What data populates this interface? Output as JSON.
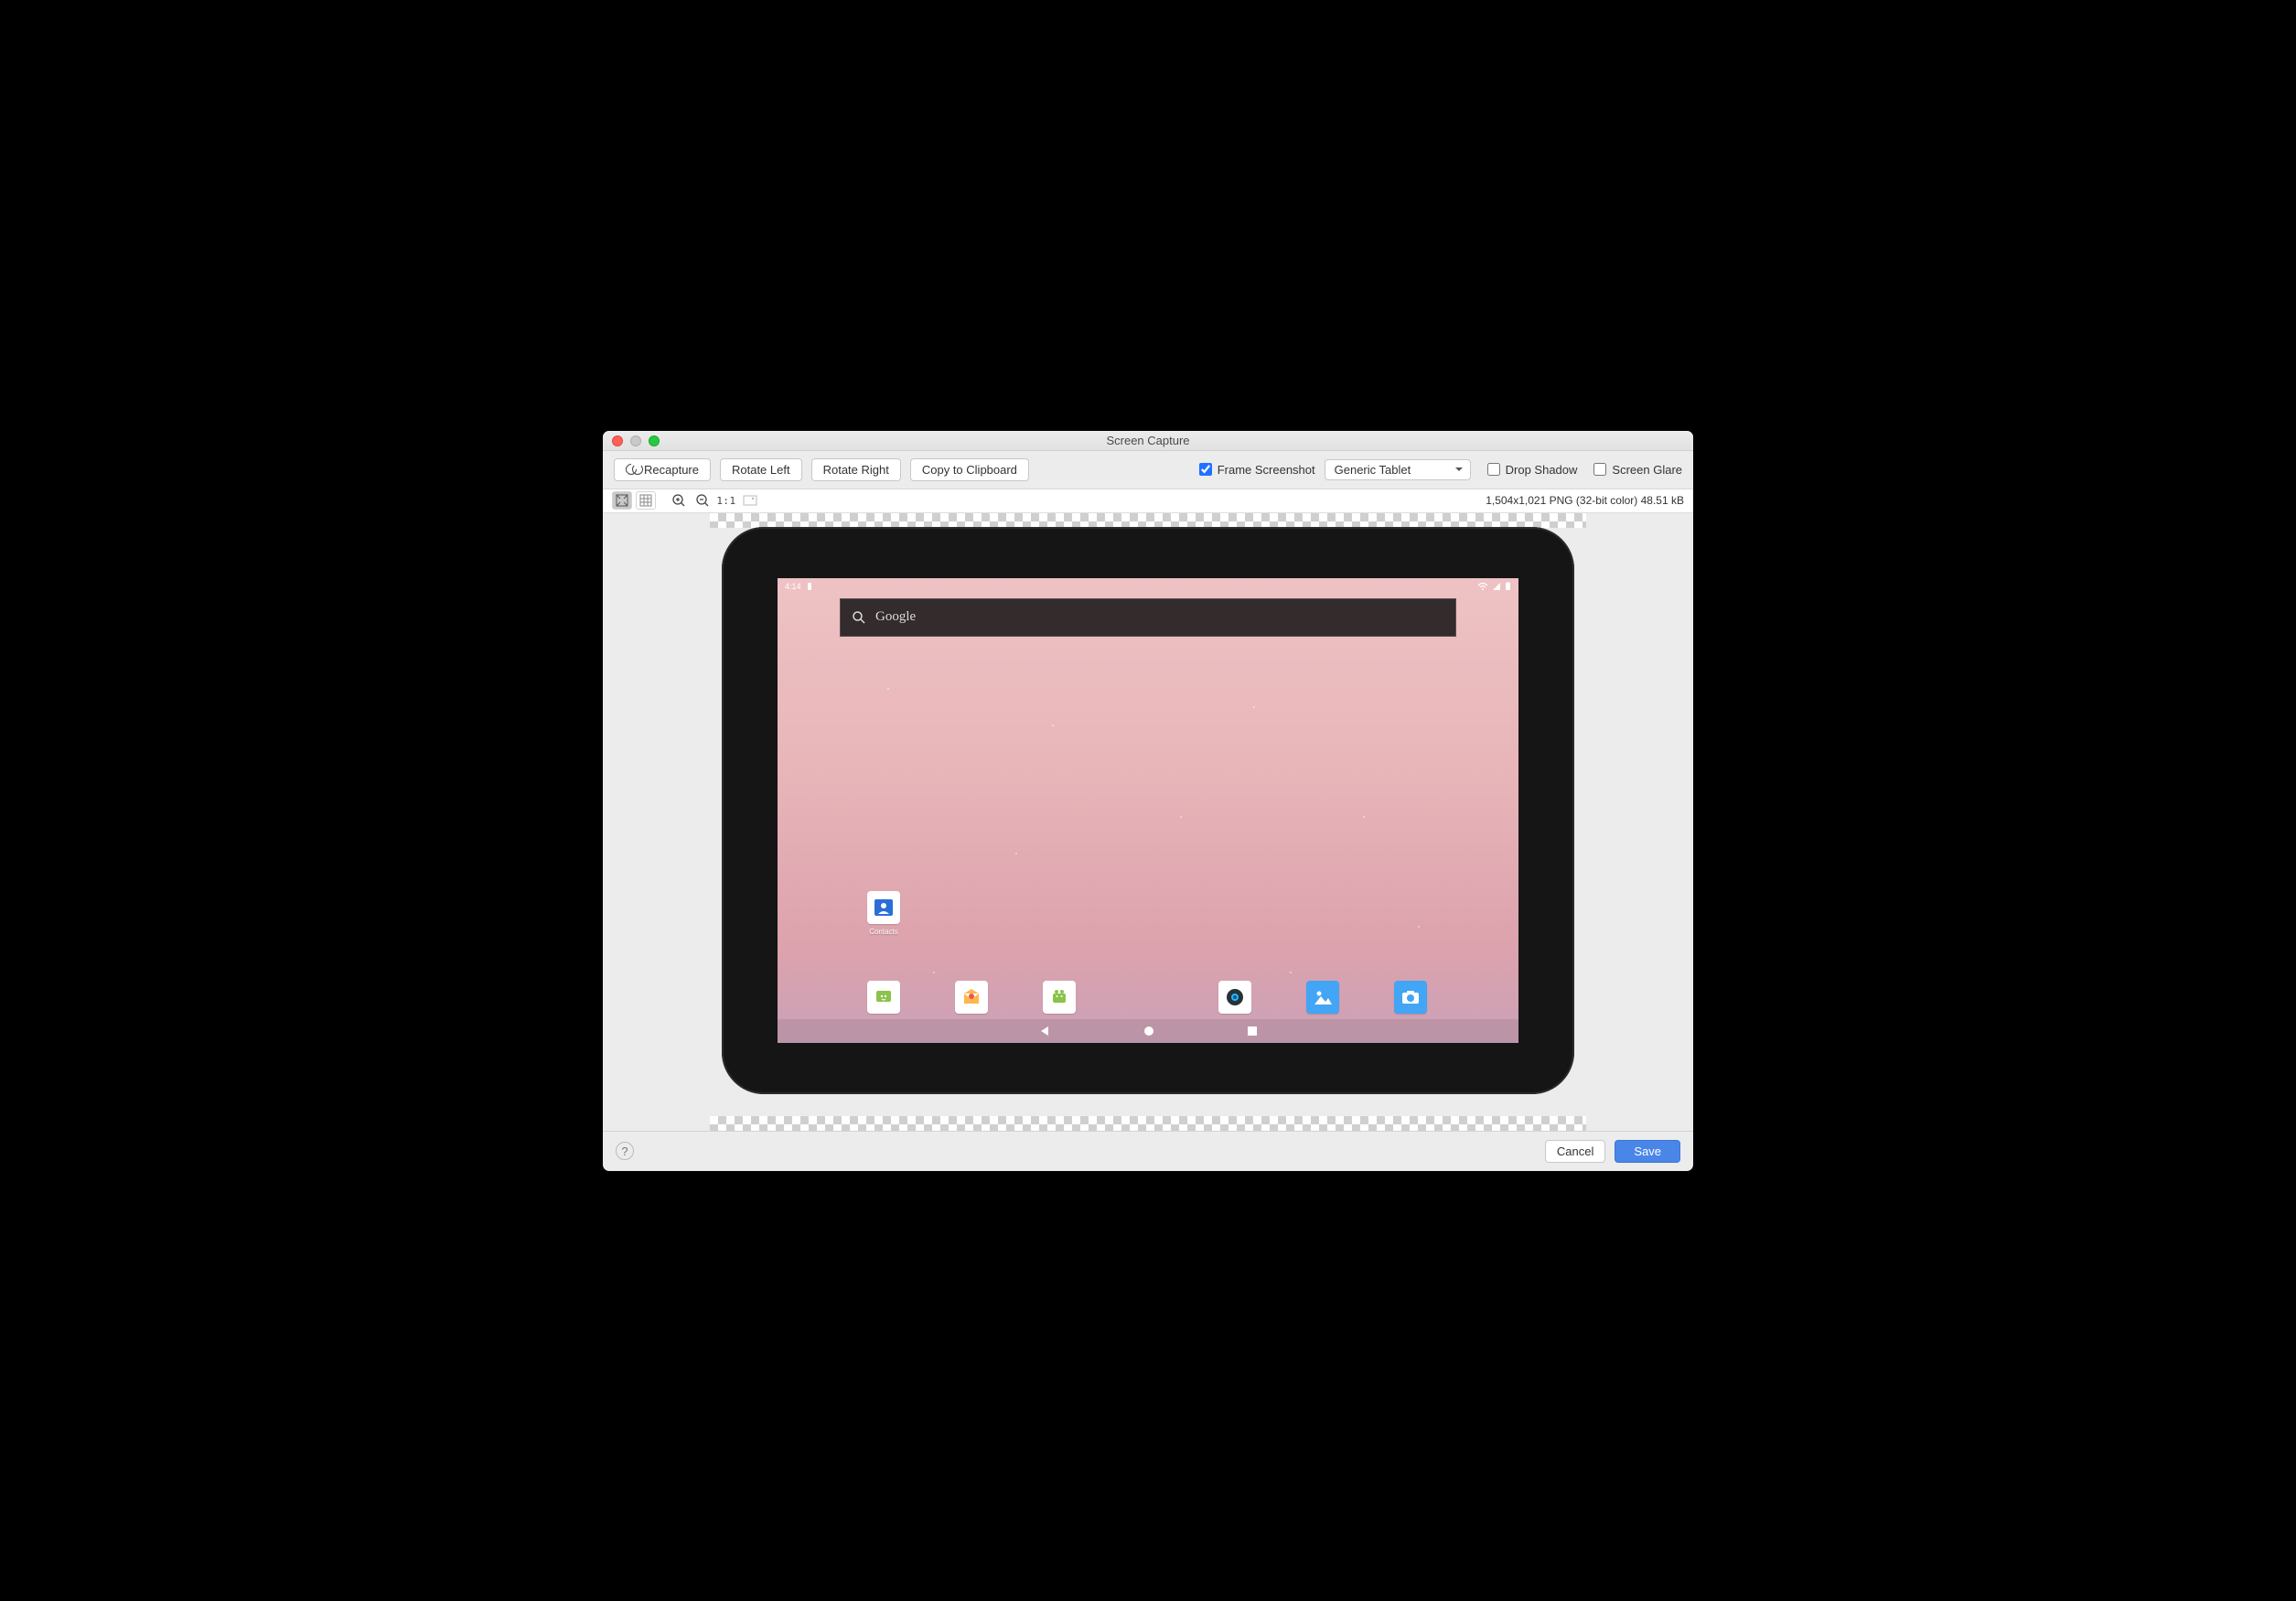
{
  "window": {
    "title": "Screen Capture"
  },
  "toolbar": {
    "recapture": "Recapture",
    "rotate_left": "Rotate Left",
    "rotate_right": "Rotate Right",
    "copy_clip": "Copy to Clipboard",
    "frame_label": "Frame Screenshot",
    "frame_checked": true,
    "device_select": "Generic Tablet",
    "drop_shadow_label": "Drop Shadow",
    "drop_shadow_checked": false,
    "glare_label": "Screen Glare",
    "glare_checked": false
  },
  "zoombar": {
    "one_to_one": "1:1",
    "info": "1,504x1,021 PNG (32-bit color) 48.51 kB"
  },
  "device": {
    "status_time": "4:14",
    "search_label": "Google",
    "contacts_label": "Contacts"
  },
  "footer": {
    "cancel": "Cancel",
    "save": "Save"
  }
}
